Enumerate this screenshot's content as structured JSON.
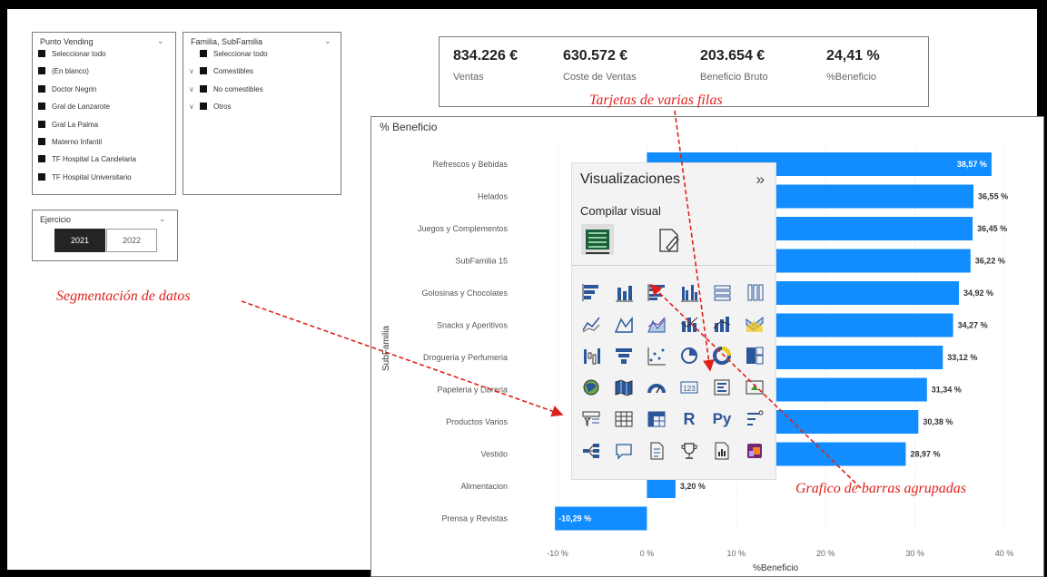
{
  "slicers": {
    "punto": {
      "title": "Punto Vending",
      "items": [
        "Seleccionar todo",
        "(En blanco)",
        "Doctor Negrin",
        "Gral de Lanzarote",
        "Gral La Palma",
        "Materno Infantil",
        "TF Hospital La Candelaria",
        "TF Hospital Universitario"
      ]
    },
    "familia": {
      "title": "Familia, SubFamilia",
      "items": [
        "Seleccionar todo",
        "Comestibles",
        "No comestibles",
        "Otros"
      ]
    },
    "ejercicio": {
      "title": "Ejercicio",
      "years": [
        "2021",
        "2022"
      ],
      "selected": "2021"
    }
  },
  "cards": [
    {
      "value": "834.226 €",
      "label": "Ventas"
    },
    {
      "value": "630.572 €",
      "label": "Coste de Ventas"
    },
    {
      "value": "203.654 €",
      "label": "Beneficio Bruto"
    },
    {
      "value": "24,41 %",
      "label": "%Beneficio"
    }
  ],
  "annotations": {
    "cards": "Tarjetas de varias filas",
    "slicer": "Segmentación de datos",
    "bars": "Grafico de barras agrupadas"
  },
  "viz_pane": {
    "title": "Visualizaciones",
    "collapse": "»",
    "subtitle": "Compilar visual",
    "icons": [
      "stacked-bar-icon",
      "stacked-column-icon",
      "clustered-bar-icon",
      "clustered-column-icon",
      "100-stacked-bar-icon",
      "100-stacked-column-icon",
      "line-chart-icon",
      "area-chart-icon",
      "stacked-area-icon",
      "line-clustered-column-icon",
      "line-stacked-column-icon",
      "ribbon-chart-icon",
      "waterfall-icon",
      "funnel-icon",
      "scatter-icon",
      "pie-chart-icon",
      "donut-chart-icon",
      "treemap-icon",
      "map-icon",
      "filled-map-icon",
      "gauge-icon",
      "card-icon",
      "multi-row-card-icon",
      "kpi-icon",
      "slicer-icon",
      "table-icon",
      "matrix-icon",
      "r-visual-icon",
      "python-visual-icon",
      "key-influencers-icon",
      "decomposition-tree-icon",
      "qna-icon",
      "smart-narrative-icon",
      "trophy-icon",
      "paginated-report-icon",
      "power-apps-icon"
    ],
    "r_label": "R",
    "py_label": "Py",
    "card_123": "123"
  },
  "colors": {
    "bar": "#118dff",
    "annotation": "#e0201b"
  },
  "chart_data": {
    "type": "bar",
    "title": "% Beneficio",
    "xlabel": "%Beneficio",
    "ylabel": "SubFamilia",
    "categories": [
      "Refrescos y Bebidas",
      "Helados",
      "Juegos y Complementos",
      "SubFamilia 15",
      "Golosinas y Chocolates",
      "Snacks y Aperitivos",
      "Drogueria y Perfumeria",
      "Papeleria y Libreria",
      "Productos Varios",
      "Vestido",
      "Alimentacion",
      "Prensa y Revistas"
    ],
    "values": [
      38.57,
      36.55,
      36.45,
      36.22,
      34.92,
      34.27,
      33.12,
      31.34,
      30.38,
      28.97,
      3.2,
      -10.29
    ],
    "value_labels": [
      "38,57 %",
      "36,55 %",
      "36,45 %",
      "36,22 %",
      "34,92 %",
      "34,27 %",
      "33,12 %",
      "31,34 %",
      "30,38 %",
      "28,97 %",
      "3,20 %",
      "-10,29 %"
    ],
    "xticks": [
      -10,
      0,
      10,
      20,
      30,
      40
    ],
    "xtick_labels": [
      "-10 %",
      "0 %",
      "10 %",
      "20 %",
      "30 %",
      "40 %"
    ],
    "xlim": [
      -10,
      40
    ],
    "grid": true
  }
}
